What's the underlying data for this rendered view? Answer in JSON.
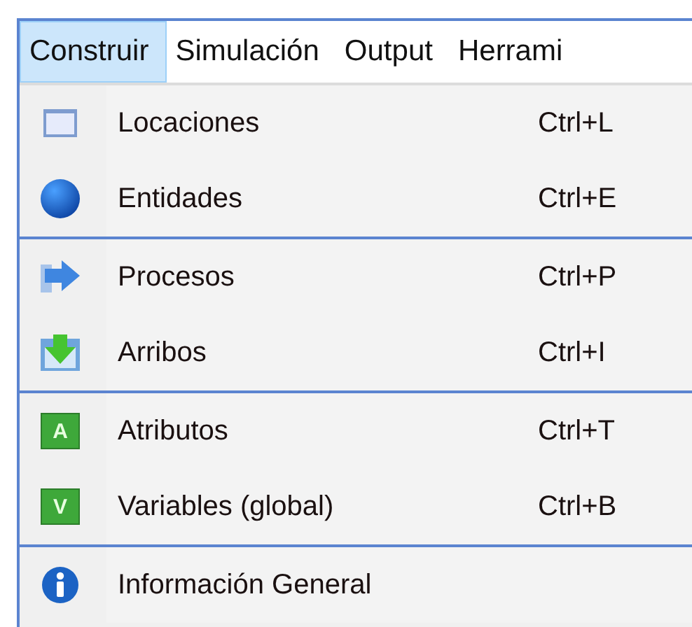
{
  "menu_bar": [
    {
      "label": "Construir",
      "selected": true
    },
    {
      "label": "Simulación",
      "selected": false
    },
    {
      "label": "Output",
      "selected": false
    },
    {
      "label": "Herrami",
      "selected": false
    }
  ],
  "menu_groups": [
    {
      "items": [
        {
          "label": "Locaciones",
          "shortcut": "Ctrl+L",
          "icon": {
            "kind": "window"
          }
        },
        {
          "label": "Entidades",
          "shortcut": "Ctrl+E",
          "icon": {
            "kind": "sphere"
          }
        }
      ]
    },
    {
      "items": [
        {
          "label": "Procesos",
          "shortcut": "Ctrl+P",
          "icon": {
            "kind": "arrow-right"
          }
        },
        {
          "label": "Arribos",
          "shortcut": "Ctrl+I",
          "icon": {
            "kind": "arrow-down"
          }
        }
      ]
    },
    {
      "items": [
        {
          "label": "Atributos",
          "shortcut": "Ctrl+T",
          "icon": {
            "kind": "letter",
            "letter": "A"
          }
        },
        {
          "label": "Variables (global)",
          "shortcut": "Ctrl+B",
          "icon": {
            "kind": "letter",
            "letter": "V"
          }
        }
      ]
    },
    {
      "items": [
        {
          "label": "Información General",
          "icon": {
            "kind": "info"
          }
        }
      ]
    }
  ]
}
